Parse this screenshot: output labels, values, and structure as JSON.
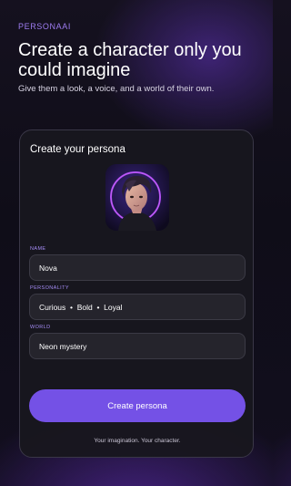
{
  "brand": "PERSONAAI",
  "headline": "Create a character only you could imagine",
  "tagline": "Give them a look, a voice, and a world of their own.",
  "card": {
    "title": "Create your persona",
    "fields": {
      "name": {
        "label": "NAME",
        "value": "Nova"
      },
      "personality": {
        "label": "PERSONALITY",
        "value": "Curious  •  Bold  •  Loyal"
      },
      "world": {
        "label": "WORLD",
        "value": "Neon mystery"
      }
    },
    "cta_label": "Create persona",
    "footnote": "Your imagination. Your character."
  },
  "colors": {
    "accent": "#7451e6",
    "label_accent": "#a58cf5",
    "background": "#15111f",
    "card": "#18171e"
  }
}
